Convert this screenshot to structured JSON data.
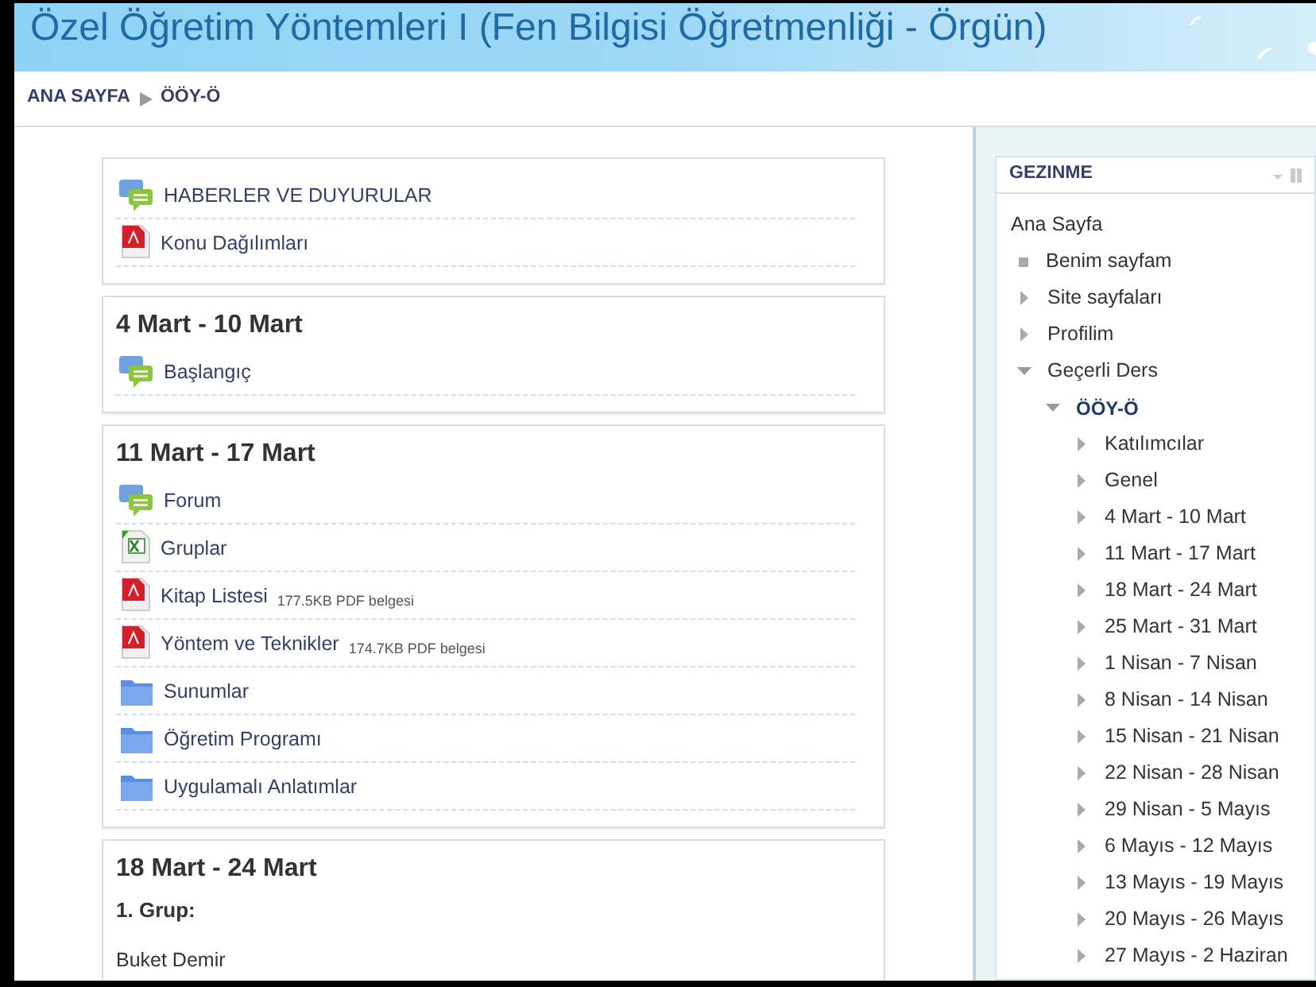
{
  "header": {
    "title": "Özel Öğretim Yöntemleri I (Fen Bilgisi Öğretmenliği - Örgün)"
  },
  "breadcrumb": [
    {
      "label": "ANA SAYFA"
    },
    {
      "label": "ÖÖY-Ö"
    }
  ],
  "sections": [
    {
      "items": [
        {
          "kind": "forum",
          "label": "HABERLER VE DUYURULAR"
        },
        {
          "kind": "pdf",
          "label": "Konu Dağılımları"
        }
      ]
    },
    {
      "title": "4 Mart - 10 Mart",
      "items": [
        {
          "kind": "forum",
          "label": "Başlangıç"
        }
      ]
    },
    {
      "title": "11 Mart - 17 Mart",
      "items": [
        {
          "kind": "forum",
          "label": "Forum"
        },
        {
          "kind": "excel",
          "label": "Gruplar"
        },
        {
          "kind": "pdf",
          "label": "Kitap Listesi",
          "size": "177.5KB PDF belgesi"
        },
        {
          "kind": "pdf",
          "label": "Yöntem ve Teknikler",
          "size": "174.7KB PDF belgesi"
        },
        {
          "kind": "folder",
          "label": "Sunumlar"
        },
        {
          "kind": "folder",
          "label": "Öğretim Programı"
        },
        {
          "kind": "folder",
          "label": "Uygulamalı Anlatımlar"
        }
      ]
    },
    {
      "title": "18 Mart - 24 Mart",
      "texts": [
        {
          "kind": "heading",
          "text": "1. Grup:"
        },
        {
          "kind": "plain",
          "text": "Buket Demir"
        }
      ]
    }
  ],
  "navigation": {
    "title": "GEZINME",
    "items": [
      {
        "kind": "home",
        "label": "Ana Sayfa"
      },
      {
        "kind": "leaf",
        "label": "Benim sayfam"
      },
      {
        "kind": "branch",
        "label": "Site sayfaları",
        "expanded": false
      },
      {
        "kind": "branch",
        "label": "Profilim",
        "expanded": false
      },
      {
        "kind": "branch",
        "label": "Geçerli Ders",
        "expanded": true,
        "children": [
          {
            "kind": "course",
            "label": "ÖÖY-Ö",
            "expanded": true,
            "children": [
              {
                "kind": "branch",
                "label": "Katılımcılar",
                "expanded": false
              },
              {
                "kind": "branch",
                "label": "Genel",
                "expanded": false
              },
              {
                "kind": "branch",
                "label": "4 Mart - 10 Mart",
                "expanded": false
              },
              {
                "kind": "branch",
                "label": "11 Mart - 17 Mart",
                "expanded": false
              },
              {
                "kind": "branch",
                "label": "18 Mart - 24 Mart",
                "expanded": false
              },
              {
                "kind": "branch",
                "label": "25 Mart - 31 Mart",
                "expanded": false
              },
              {
                "kind": "branch",
                "label": "1 Nisan - 7 Nisan",
                "expanded": false
              },
              {
                "kind": "branch",
                "label": "8 Nisan - 14 Nisan",
                "expanded": false
              },
              {
                "kind": "branch",
                "label": "15 Nisan - 21 Nisan",
                "expanded": false
              },
              {
                "kind": "branch",
                "label": "22 Nisan - 28 Nisan",
                "expanded": false
              },
              {
                "kind": "branch",
                "label": "29 Nisan - 5 Mayıs",
                "expanded": false
              },
              {
                "kind": "branch",
                "label": "6 Mayıs - 12 Mayıs",
                "expanded": false
              },
              {
                "kind": "branch",
                "label": "13 Mayıs - 19 Mayıs",
                "expanded": false
              },
              {
                "kind": "branch",
                "label": "20 Mayıs - 26 Mayıs",
                "expanded": false
              },
              {
                "kind": "branch",
                "label": "27 Mayıs - 2 Haziran",
                "expanded": false
              }
            ]
          }
        ]
      }
    ]
  }
}
